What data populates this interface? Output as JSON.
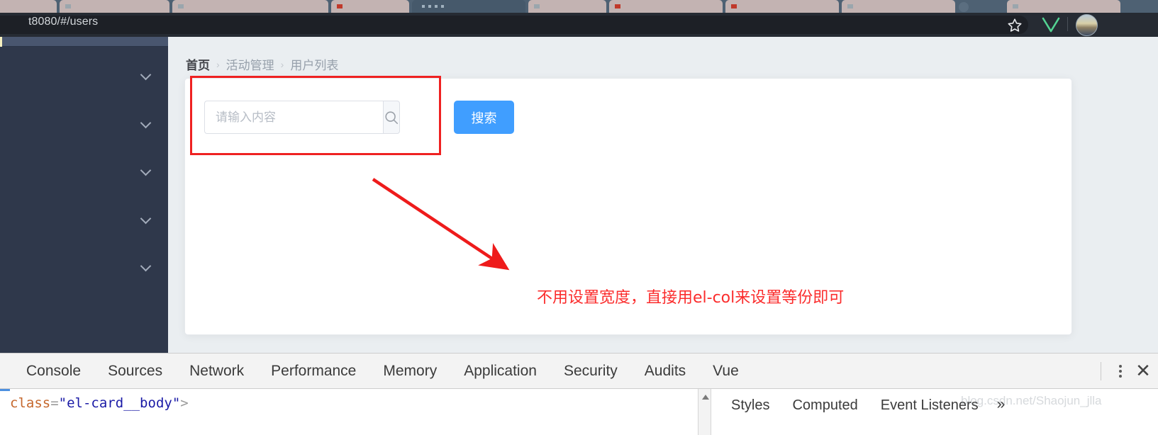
{
  "browser": {
    "url": "t8080/#/users",
    "bookmark_icon": "star-icon",
    "extension_icon": "vue-devtools-icon",
    "avatar_icon": "profile-avatar"
  },
  "sidebar": {
    "items": [
      {
        "icon": "chevron-down-icon"
      },
      {
        "icon": "chevron-down-icon"
      },
      {
        "icon": "chevron-down-icon"
      },
      {
        "icon": "chevron-down-icon"
      },
      {
        "icon": "chevron-down-icon"
      }
    ]
  },
  "breadcrumb": {
    "items": [
      "首页",
      "活动管理",
      "用户列表"
    ],
    "separator": "›"
  },
  "card": {
    "search": {
      "placeholder": "请输入内容",
      "value": "",
      "append_icon": "search-icon",
      "button_label": "搜索"
    }
  },
  "annotations": {
    "note_text": "不用设置宽度，直接用el-col来设置等份即可",
    "note_color": "#fb2c2c",
    "box_color": "#ef2121",
    "arrow_color": "#ee1b1b"
  },
  "devtools": {
    "tabs": [
      "Console",
      "Sources",
      "Network",
      "Performance",
      "Memory",
      "Application",
      "Security",
      "Audits",
      "Vue"
    ],
    "menu_icon": "kebab-menu-icon",
    "close_icon": "close-icon",
    "elements_panel": {
      "code_line_1": {
        "attr": "class",
        "eq": "=",
        "quote_open": "\"",
        "value": "el-card__body",
        "quote_close": "\"",
        "tail": ">"
      },
      "scroll_icon": "scroll-up-arrow-icon"
    },
    "styles_panel": {
      "tabs": [
        "Styles",
        "Computed",
        "Event Listeners"
      ],
      "overflow_label": "»"
    }
  },
  "watermark": {
    "text": "blog.csdn.net/Shaojun_jlla"
  },
  "colors": {
    "accent_blue": "#409eff",
    "sidebar_dark": "#2f384b",
    "page_bg": "#eaeef1",
    "annotation_red": "#fb2c2c"
  }
}
